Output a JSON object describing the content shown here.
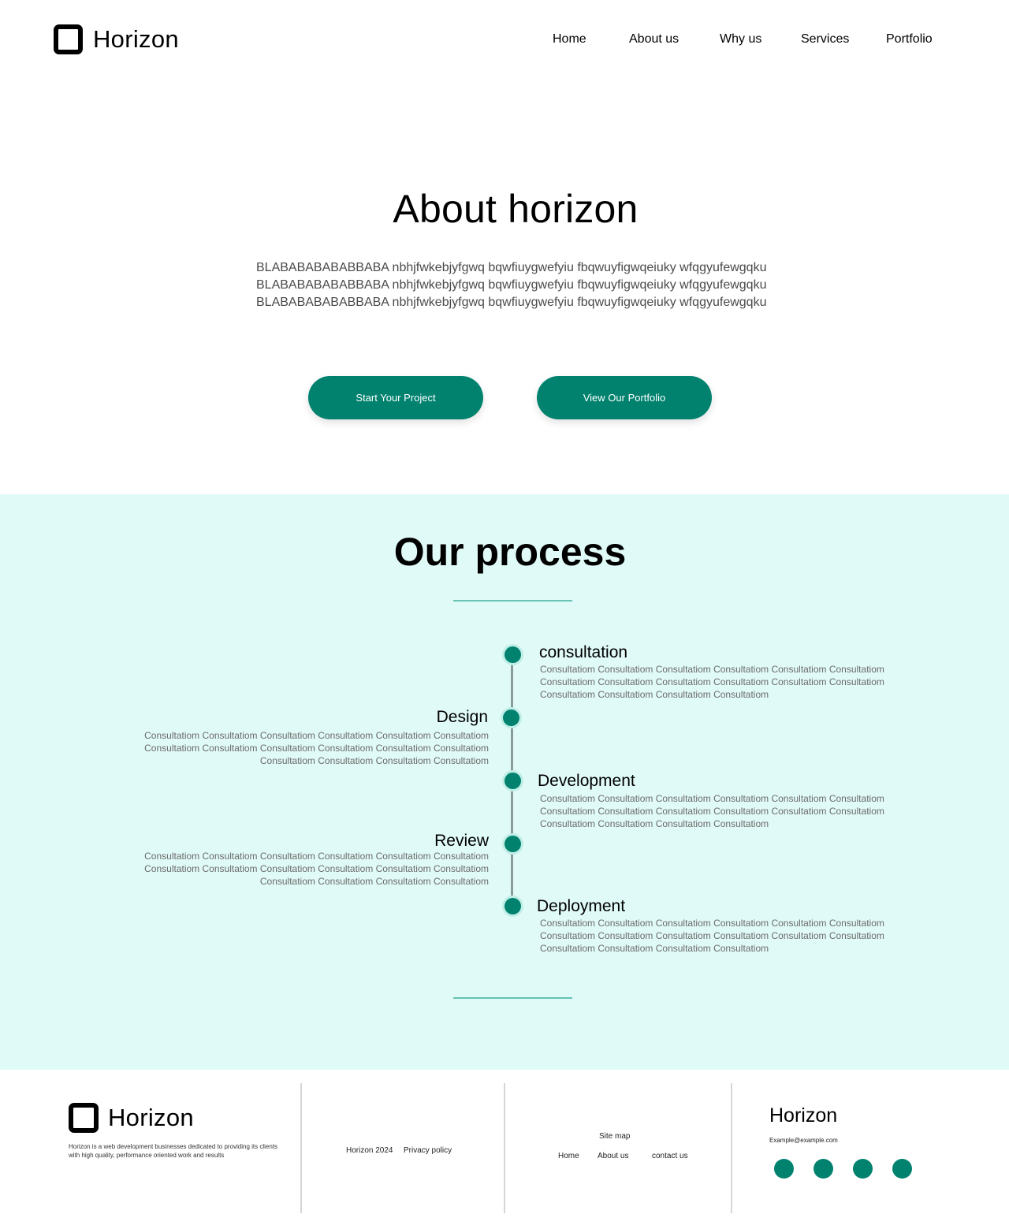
{
  "header": {
    "brand": "Horizon",
    "nav": [
      "Home",
      "About us",
      "Why us",
      "Services",
      "Portfolio"
    ]
  },
  "hero": {
    "title": "About horizon",
    "body_lines": [
      "BLABABABABABBABA nbhjfwkebjyfgwq bqwfiuygwefyiu fbqwuyfigwqeiuky wfqgyufewgqku",
      "BLABABABABABBABA nbhjfwkebjyfgwq bqwfiuygwefyiu fbqwuyfigwqeiuky wfqgyufewgqku",
      "BLABABABABABBABA nbhjfwkebjyfgwq bqwfiuygwefyiu fbqwuyfigwqeiuky wfqgyufewgqku"
    ],
    "primary_button": "Start Your Project",
    "secondary_button": "View Our Portfolio"
  },
  "process": {
    "title": "Our process",
    "steps": [
      {
        "title": "consultation",
        "desc": "Consultatiom Consultatiom Consultatiom Consultatiom Consultatiom Consultatiom Consultatiom Consultatiom Consultatiom Consultatiom Consultatiom Consultatiom Consultatiom Consultatiom Consultatiom Consultatiom"
      },
      {
        "title": "Design",
        "desc": "Consultatiom Consultatiom Consultatiom Consultatiom Consultatiom Consultatiom Consultatiom Consultatiom Consultatiom Consultatiom Consultatiom Consultatiom Consultatiom Consultatiom Consultatiom Consultatiom"
      },
      {
        "title": "Development",
        "desc": "Consultatiom Consultatiom Consultatiom Consultatiom Consultatiom Consultatiom Consultatiom Consultatiom Consultatiom Consultatiom Consultatiom Consultatiom Consultatiom Consultatiom Consultatiom Consultatiom"
      },
      {
        "title": "Review",
        "desc": "Consultatiom Consultatiom Consultatiom Consultatiom Consultatiom Consultatiom Consultatiom Consultatiom Consultatiom Consultatiom Consultatiom Consultatiom Consultatiom Consultatiom Consultatiom Consultatiom"
      },
      {
        "title": "Deployment",
        "desc": "Consultatiom Consultatiom Consultatiom Consultatiom Consultatiom Consultatiom Consultatiom Consultatiom Consultatiom Consultatiom Consultatiom Consultatiom Consultatiom Consultatiom Consultatiom Consultatiom"
      }
    ]
  },
  "footer": {
    "brand": "Horizon",
    "about": "Horizon is a web development businesses dedicated to providing its clients with high quality, performance oriented work and results",
    "copyright": "Horizon 2024",
    "privacy": "Privacy policy",
    "sitemap_title": "Site map",
    "sitemap_links": [
      "Home",
      "About us",
      "contact us"
    ],
    "contact_brand": "Horizon",
    "email": "Example@example.com",
    "social_icons": [
      "social-icon-1",
      "social-icon-2",
      "social-icon-3",
      "social-icon-4"
    ]
  },
  "colors": {
    "accent": "#00826f",
    "process_bg": "#e0faf7",
    "divider": "#66c2b4"
  }
}
